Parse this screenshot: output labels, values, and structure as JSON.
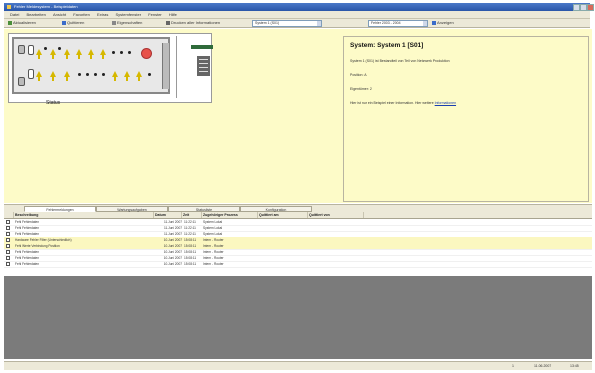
{
  "window": {
    "title": "Fehler Meldesystem - Beispieldaten"
  },
  "menu": {
    "items": [
      "Datei",
      "Bearbeiten",
      "Ansicht",
      "Favoriten",
      "Extras",
      "Systemfenster",
      "Fenster",
      "Hilfe"
    ]
  },
  "toolbar": {
    "refresh_label": "Aktualisieren",
    "acknowledge_label": "Quittieren",
    "properties_label": "Eigenschaften",
    "print_label": "Drucken aller Informationen",
    "system_combo": "System 1 (S01)",
    "filter_combo": "Fehler 2003 - 2004",
    "go_label": "Anzeigen"
  },
  "device": {
    "label": "Status"
  },
  "info": {
    "title": "System: System 1 [S01]",
    "line1": "System 1 (S01) ist Bestandteil von Teil von Netzwerk Produktion",
    "line2": "Position: A",
    "line3": "Eigentümer: 2",
    "line4_prefix": "Hier ist nur ein Beispiel einer Information. Hier weitere",
    "line4_link": "Informationen"
  },
  "tabs": [
    "Fehlermeldungen",
    "Wartungsaufgaben",
    "Statusliste",
    "Konfiguration"
  ],
  "table": {
    "columns": [
      "Beschreibung",
      "Datum",
      "Zeit",
      "Zugehöriger Prozess",
      "Quittiert am",
      "Quittiert von"
    ],
    "rows": [
      {
        "desc": "Fehl Fehlerdaten",
        "date": "11.Juni 2007",
        "time": "11:22:11",
        "proc": "System Lokal",
        "hl": false
      },
      {
        "desc": "Fehl Fehlerdaten",
        "date": "11.Juni 2007",
        "time": "11:22:11",
        "proc": "System Lokal",
        "hl": false
      },
      {
        "desc": "Fehl Fehlerdaten",
        "date": "11.Juni 2007",
        "time": "11:22:11",
        "proc": "System Lokal",
        "hl": false
      },
      {
        "desc": "Hardware Fehler Filter (Unterschiedlich)",
        "date": "10.Juni 2007",
        "time": "15:08:11",
        "proc": "Intern - Router",
        "hl": true
      },
      {
        "desc": "Fehl Werte Verbindung Position",
        "date": "10.Juni 2007",
        "time": "15:08:11",
        "proc": "Intern - Router",
        "hl": true
      },
      {
        "desc": "Fehl Fehlerdaten",
        "date": "10.Juni 2007",
        "time": "15:08:11",
        "proc": "Intern - Router",
        "hl": false
      },
      {
        "desc": "Fehl Fehlerdaten",
        "date": "10.Juni 2007",
        "time": "15:08:11",
        "proc": "Intern - Router",
        "hl": false
      },
      {
        "desc": "Fehl Fehlerdaten",
        "date": "10.Juni 2007",
        "time": "15:08:11",
        "proc": "Intern - Router",
        "hl": false
      }
    ]
  },
  "status": {
    "count": "1",
    "date": "11.06.2007",
    "time": "13:45"
  }
}
